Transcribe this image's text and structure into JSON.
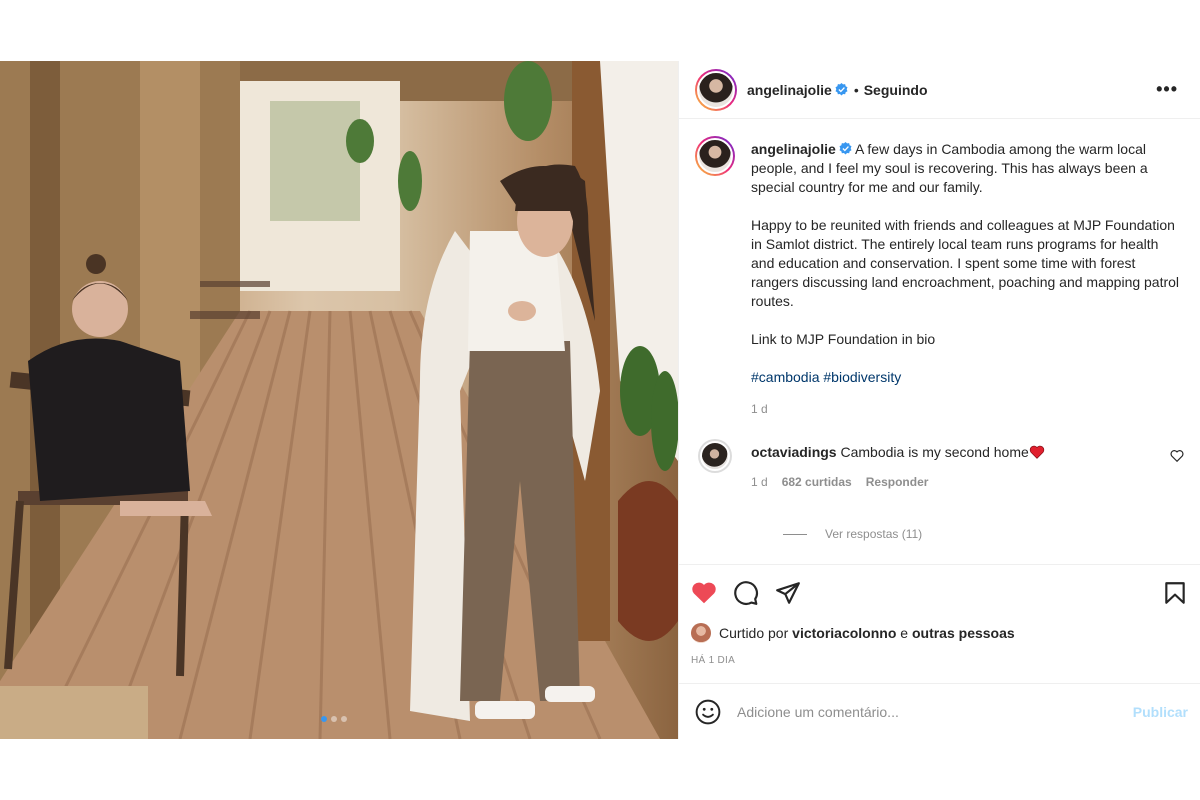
{
  "post": {
    "author": "angelinajolie",
    "follow_separator": "•",
    "follow_status": "Seguindo",
    "more_glyph": "•••",
    "caption_paragraphs": [
      "A few days in Cambodia among the warm local people, and I feel my soul is recovering. This has always been a special country for me and our family.",
      "Happy to be reunited with friends and colleagues at MJP Foundation in Samlot district. The entirely local team runs programs for health and education and conservation. I spent some time with forest rangers discussing land encroachment, poaching and mapping patrol routes.",
      "Link to MJP Foundation in bio"
    ],
    "hashtags": [
      "#cambodia",
      "#biodiversity"
    ],
    "caption_time": "1 d",
    "carousel": {
      "count": 3,
      "active_index": 0
    }
  },
  "comments": [
    {
      "username": "octaviadings",
      "text": "Cambodia is my second home",
      "emoji": "heart",
      "time": "1 d",
      "likes": "682 curtidas",
      "reply_label": "Responder",
      "view_replies": "Ver respostas (11)"
    }
  ],
  "actions": {
    "liked": true,
    "like_color": "#ed4956",
    "likes_prefix": "Curtido por",
    "likes_user": "victoriacolonno",
    "likes_join": "e",
    "likes_others": "outras pessoas",
    "date": "HÁ 1 DIA"
  },
  "comment_box": {
    "placeholder": "Adicione um comentário...",
    "publish_label": "Publicar"
  },
  "colors": {
    "verified": "#3897f0",
    "hashtag": "#00376b",
    "secondary_text": "#8e8e8e",
    "publish_disabled": "#b2dffc"
  },
  "icons": [
    "verified-badge-icon",
    "heart-icon",
    "comment-icon",
    "share-icon",
    "bookmark-icon",
    "emoji-icon",
    "more-options-icon"
  ]
}
